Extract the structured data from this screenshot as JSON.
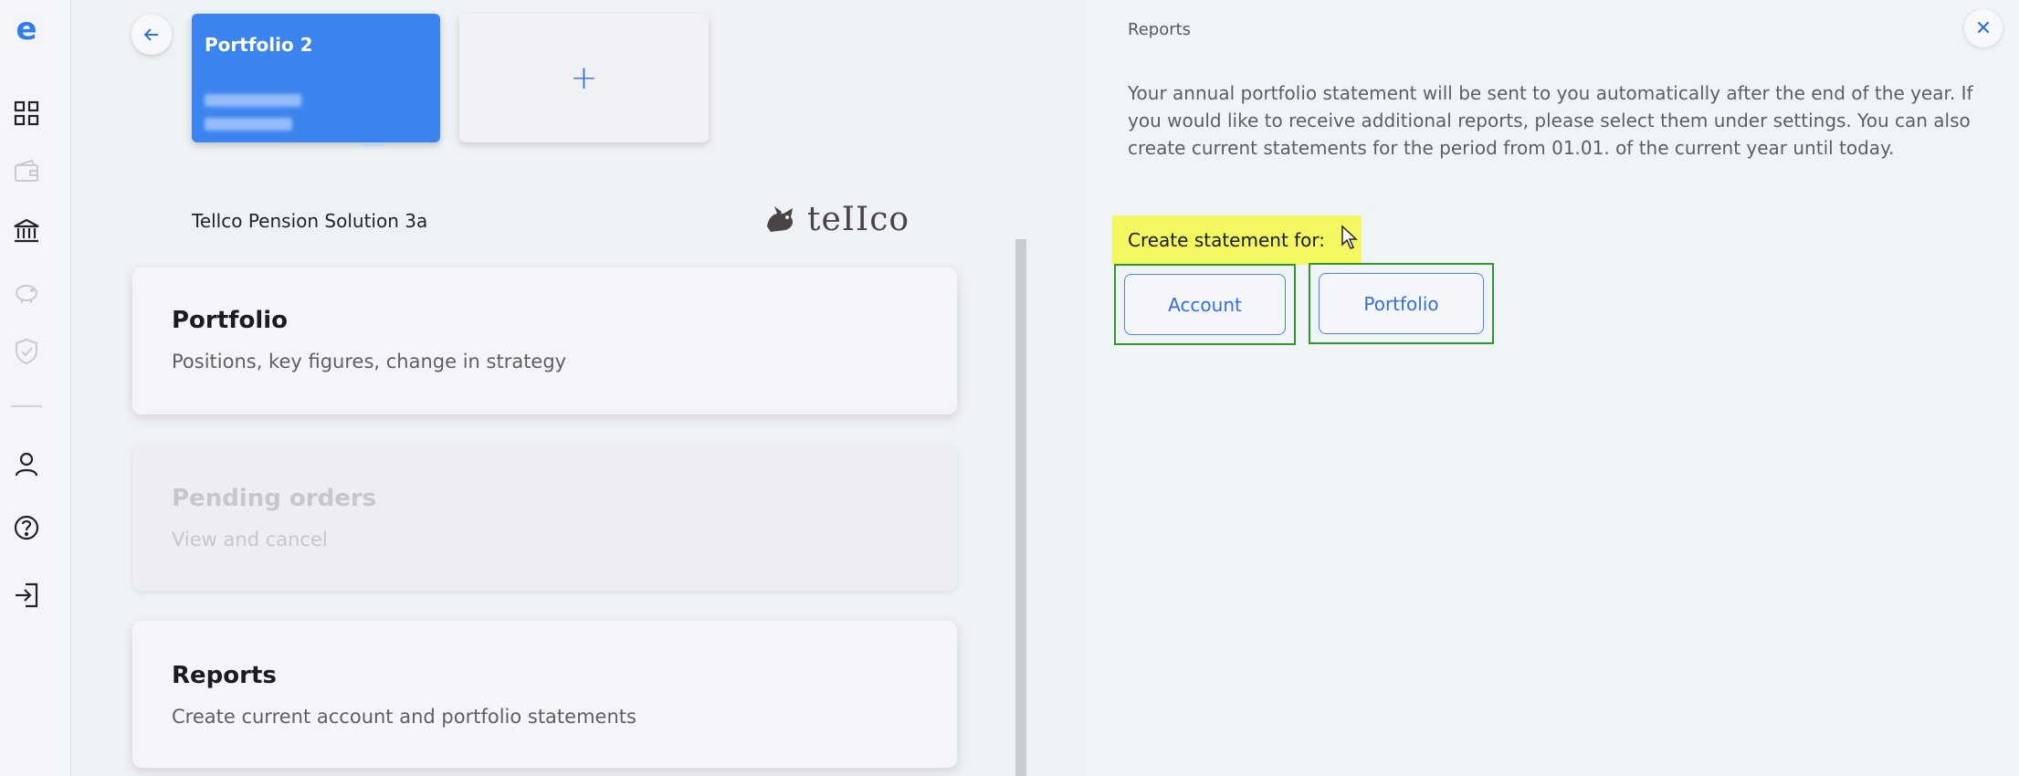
{
  "rail": {
    "items": [
      {
        "name": "logo-e-icon"
      },
      {
        "name": "dashboard-grid-icon"
      },
      {
        "name": "wallet-icon"
      },
      {
        "name": "bank-icon"
      },
      {
        "name": "piggy-bank-icon"
      },
      {
        "name": "shield-check-icon"
      },
      {
        "name": "user-icon"
      },
      {
        "name": "help-icon"
      },
      {
        "name": "logout-icon"
      }
    ],
    "logo_letter": "e"
  },
  "portfolio_switcher": {
    "active_card": {
      "name": "Portfolio 2"
    },
    "add_label": "+"
  },
  "product": {
    "name": "Tellco Pension Solution 3a",
    "logo_text": "teIIco"
  },
  "menu": [
    {
      "title": "Portfolio",
      "subtitle": "Positions, key figures, change in strategy",
      "enabled": true
    },
    {
      "title": "Pending orders",
      "subtitle": "View and cancel",
      "enabled": false
    },
    {
      "title": "Reports",
      "subtitle": "Create current account and portfolio statements",
      "enabled": true
    }
  ],
  "reports_panel": {
    "title": "Reports",
    "close_label": "✕",
    "intro": "Your annual portfolio statement will be sent to you automatically after the end of the year. If you would like to receive additional reports, please select them under settings. You can also create current statements for the period from 01.01. of the current year until today.",
    "create_label": "Create statement for:",
    "buttons": {
      "account": "Account",
      "portfolio": "Portfolio"
    }
  },
  "colors": {
    "accent": "#2f6fe0",
    "active_card": "#3b84f0",
    "highlight": "#f3f760",
    "focus_outline": "#2c9a28"
  }
}
